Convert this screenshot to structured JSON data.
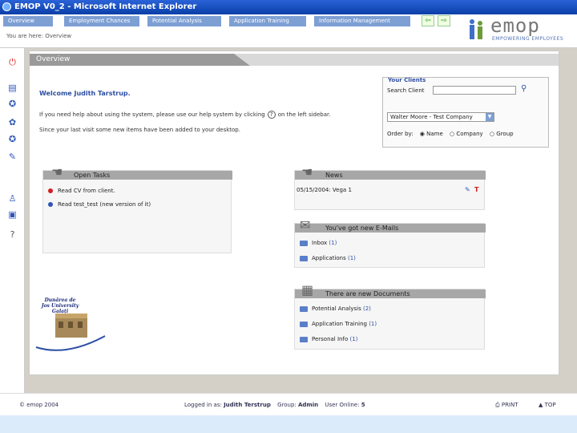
{
  "window": {
    "title": "EMOP V0_2 - Microsoft Internet Explorer"
  },
  "nav": {
    "tabs": [
      {
        "label": "Overview"
      },
      {
        "label": "Employment Chances"
      },
      {
        "label": "Potential Analysis"
      },
      {
        "label": "Application Training"
      },
      {
        "label": "Information Management"
      }
    ],
    "breadcrumb": "You are here: Overview"
  },
  "brand": {
    "name": "emop",
    "tagline": "EMPOWERING EMPLOYEES"
  },
  "overview": {
    "header": "Overview",
    "welcome": "Welcome Judith Tarstrup.",
    "help_before": "If you need help about using the system, please use our help system by clicking",
    "help_after": "on the left sidebar.",
    "since": "Since your last visit some new items have been added to your desktop."
  },
  "clients": {
    "title": "Your Clients",
    "search_label": "Search Client",
    "search_value": "",
    "selected_client": "Walter Moore - Test Company",
    "order_label": "Order by:",
    "order_options": [
      "Name",
      "Company",
      "Group"
    ],
    "order_selected": "Name"
  },
  "open_tasks": {
    "title": "Open Tasks",
    "items": [
      {
        "label": "Read CV from client.",
        "color": "#d22020"
      },
      {
        "label": "Read test_test (new version of it)",
        "color": "#2d55b8"
      }
    ]
  },
  "news": {
    "title": "News",
    "items": [
      {
        "label": "05/15/2004: Vega 1"
      }
    ]
  },
  "emails": {
    "title": "You've got new E-Mails",
    "items": [
      {
        "label": "Inbox",
        "count": "(1)"
      },
      {
        "label": "Applications",
        "count": "(1)"
      }
    ]
  },
  "documents": {
    "title": "There are new Documents",
    "items": [
      {
        "label": "Potential Analysis",
        "count": "(2)"
      },
      {
        "label": "Application Training",
        "count": "(1)"
      },
      {
        "label": "Personal Info",
        "count": "(1)"
      }
    ]
  },
  "university": {
    "name": "Dunărea de Jos University Galați"
  },
  "footer": {
    "copyright": "© emop 2004",
    "logged_label": "Logged in as:",
    "user": "Judith Terstrup",
    "group_label": "Group:",
    "group": "Admin",
    "online_label": "User Online:",
    "online_count": "5",
    "print": "PRINT",
    "top": "TOP"
  },
  "colors": {
    "accent": "#2c4ea3",
    "tab": "#7d9fd4",
    "title_bar": "#0b3fa8",
    "status_bar": "#dcebfa"
  },
  "icons": {
    "sidebar": [
      "logout-icon",
      "directory-icon",
      "chances-icon",
      "analysis-icon",
      "training-icon",
      "info-icon",
      "help-icon",
      "profile-icon",
      "help-question-icon"
    ]
  }
}
